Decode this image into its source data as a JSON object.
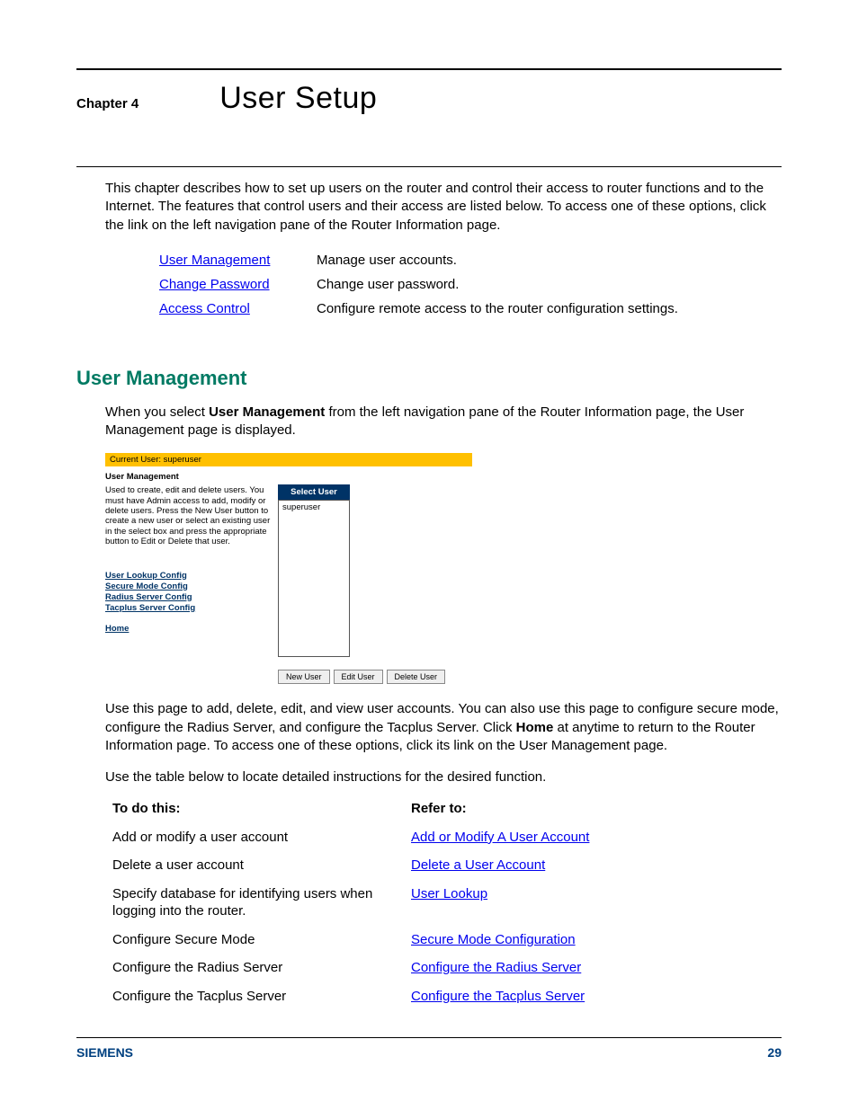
{
  "chapter": {
    "label": "Chapter 4",
    "title": "User Setup"
  },
  "intro": "This chapter describes how to set up users on the router and control their access to router functions and to the Internet. The features that control users and their access are listed below. To access one of these options, click the link on the left navigation pane of the Router Information page.",
  "nav": [
    {
      "link": "User Management",
      "desc": "Manage user accounts."
    },
    {
      "link": "Change Password",
      "desc": "Change user password."
    },
    {
      "link": "Access Control",
      "desc": "Configure remote access to the router configuration settings."
    }
  ],
  "section": {
    "heading": "User Management",
    "p1_a": "When you select ",
    "p1_b": "User Management",
    "p1_c": " from the left navigation pane of the Router Information page, the User Management page is displayed.",
    "p2_a": "Use this page to add, delete, edit, and view user accounts. You can also use this page to configure secure mode, configure the Radius Server, and configure the Tacplus Server. Click ",
    "p2_b": "Home",
    "p2_c": " at anytime to return to the Router Information page. To access one of these options, click its link on the User Management page.",
    "p3": "Use the table below to locate detailed instructions for the desired function."
  },
  "mini": {
    "current_user": "Current User: superuser",
    "heading": "User Management",
    "desc": "Used to create, edit and delete users. You must have Admin access to add, modify or delete users. Press the New User button to create a new user or select an existing user in the select box and press the appropriate button to Edit or Delete that user.",
    "nav": [
      "User Lookup Config",
      "Secure Mode Config",
      "Radius Server Config",
      "Tacplus Server Config"
    ],
    "home": "Home",
    "select_header": "Select User",
    "select_items": [
      "superuser"
    ],
    "buttons": [
      "New User",
      "Edit User",
      "Delete User"
    ]
  },
  "ref": {
    "head_a": "To do this:",
    "head_b": "Refer to:",
    "rows": [
      {
        "a": "Add or modify a user account",
        "b": "Add or Modify A User Account"
      },
      {
        "a": "Delete a user account",
        "b": "Delete a User Account"
      },
      {
        "a": "Specify database for identifying users when logging into the router.",
        "b": "User Lookup"
      },
      {
        "a": "Configure Secure Mode",
        "b": "Secure Mode Configuration"
      },
      {
        "a": "Configure the Radius Server",
        "b": "Configure the Radius Server"
      },
      {
        "a": "Configure the Tacplus Server",
        "b": "Configure the Tacplus Server"
      }
    ]
  },
  "footer": {
    "brand": "SIEMENS",
    "page_no": "29"
  }
}
